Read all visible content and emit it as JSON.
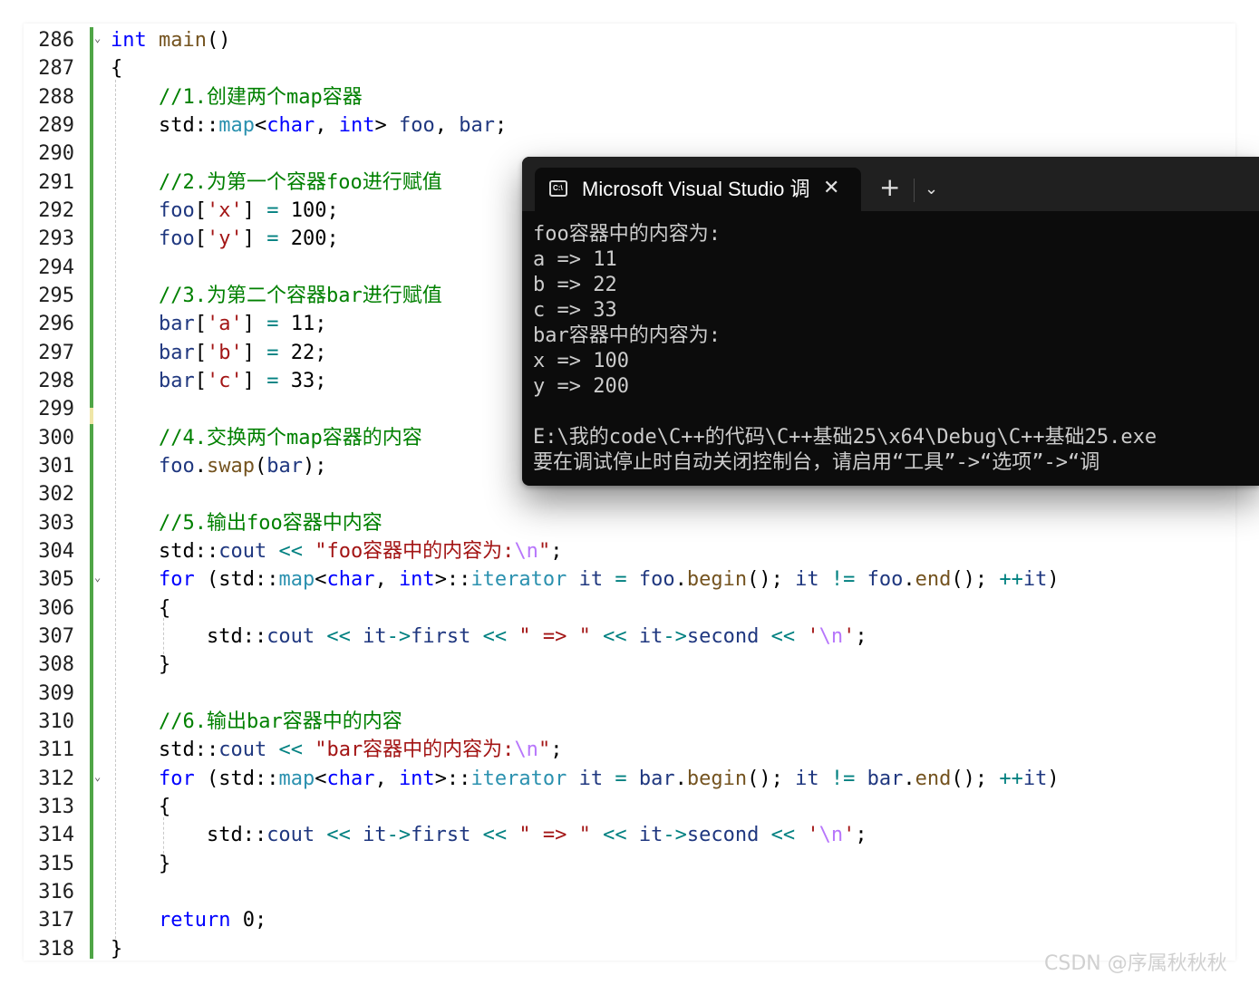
{
  "editor": {
    "lines": [
      {
        "n": "286",
        "fold": "⌄",
        "tokens": [
          [
            "kw",
            "int"
          ],
          [
            "p",
            " "
          ],
          [
            "fn",
            "main"
          ],
          [
            "p",
            "()"
          ]
        ]
      },
      {
        "n": "287",
        "tokens": [
          [
            "p",
            "{"
          ]
        ]
      },
      {
        "n": "288",
        "tokens": [
          [
            "p",
            "    "
          ],
          [
            "cm",
            "//1.创建两个map容器"
          ]
        ]
      },
      {
        "n": "289",
        "tokens": [
          [
            "p",
            "    std::"
          ],
          [
            "ty",
            "map"
          ],
          [
            "p",
            "<"
          ],
          [
            "kw",
            "char"
          ],
          [
            "p",
            ", "
          ],
          [
            "kw",
            "int"
          ],
          [
            "p",
            "> "
          ],
          [
            "var",
            "foo"
          ],
          [
            "p",
            ", "
          ],
          [
            "var",
            "bar"
          ],
          [
            "p",
            ";"
          ]
        ]
      },
      {
        "n": "290",
        "tokens": []
      },
      {
        "n": "291",
        "tokens": [
          [
            "p",
            "    "
          ],
          [
            "cm",
            "//2.为第一个容器foo进行赋值"
          ]
        ]
      },
      {
        "n": "292",
        "tokens": [
          [
            "p",
            "    "
          ],
          [
            "var",
            "foo"
          ],
          [
            "p",
            "["
          ],
          [
            "str",
            "'x'"
          ],
          [
            "p",
            "] "
          ],
          [
            "op",
            "="
          ],
          [
            "p",
            " 100;"
          ]
        ]
      },
      {
        "n": "293",
        "tokens": [
          [
            "p",
            "    "
          ],
          [
            "var",
            "foo"
          ],
          [
            "p",
            "["
          ],
          [
            "str",
            "'y'"
          ],
          [
            "p",
            "] "
          ],
          [
            "op",
            "="
          ],
          [
            "p",
            " 200;"
          ]
        ]
      },
      {
        "n": "294",
        "tokens": []
      },
      {
        "n": "295",
        "tokens": [
          [
            "p",
            "    "
          ],
          [
            "cm",
            "//3.为第二个容器bar进行赋值"
          ]
        ]
      },
      {
        "n": "296",
        "tokens": [
          [
            "p",
            "    "
          ],
          [
            "var",
            "bar"
          ],
          [
            "p",
            "["
          ],
          [
            "str",
            "'a'"
          ],
          [
            "p",
            "] "
          ],
          [
            "op",
            "="
          ],
          [
            "p",
            " 11;"
          ]
        ]
      },
      {
        "n": "297",
        "tokens": [
          [
            "p",
            "    "
          ],
          [
            "var",
            "bar"
          ],
          [
            "p",
            "["
          ],
          [
            "str",
            "'b'"
          ],
          [
            "p",
            "] "
          ],
          [
            "op",
            "="
          ],
          [
            "p",
            " 22;"
          ]
        ]
      },
      {
        "n": "298",
        "tokens": [
          [
            "p",
            "    "
          ],
          [
            "var",
            "bar"
          ],
          [
            "p",
            "["
          ],
          [
            "str",
            "'c'"
          ],
          [
            "p",
            "] "
          ],
          [
            "op",
            "="
          ],
          [
            "p",
            " 33;"
          ]
        ]
      },
      {
        "n": "299",
        "tokens": []
      },
      {
        "n": "300",
        "tokens": [
          [
            "p",
            "    "
          ],
          [
            "cm",
            "//4.交换两个map容器的内容"
          ]
        ]
      },
      {
        "n": "301",
        "tokens": [
          [
            "p",
            "    "
          ],
          [
            "var",
            "foo"
          ],
          [
            "p",
            "."
          ],
          [
            "fn",
            "swap"
          ],
          [
            "p",
            "("
          ],
          [
            "var",
            "bar"
          ],
          [
            "p",
            ");"
          ]
        ]
      },
      {
        "n": "302",
        "tokens": []
      },
      {
        "n": "303",
        "tokens": [
          [
            "p",
            "    "
          ],
          [
            "cm",
            "//5.输出foo容器中内容"
          ]
        ]
      },
      {
        "n": "304",
        "tokens": [
          [
            "p",
            "    std::"
          ],
          [
            "var",
            "cout"
          ],
          [
            "p",
            " "
          ],
          [
            "op",
            "<<"
          ],
          [
            "p",
            " "
          ],
          [
            "str",
            "\"foo容器中的内容为:"
          ],
          [
            "esc",
            "\\n"
          ],
          [
            "str",
            "\""
          ],
          [
            "p",
            ";"
          ]
        ]
      },
      {
        "n": "305",
        "fold": "⌄",
        "tokens": [
          [
            "p",
            "    "
          ],
          [
            "kw",
            "for"
          ],
          [
            "p",
            " (std::"
          ],
          [
            "ty",
            "map"
          ],
          [
            "p",
            "<"
          ],
          [
            "kw",
            "char"
          ],
          [
            "p",
            ", "
          ],
          [
            "kw",
            "int"
          ],
          [
            "p",
            ">::"
          ],
          [
            "ty",
            "iterator"
          ],
          [
            "p",
            " "
          ],
          [
            "var",
            "it"
          ],
          [
            "p",
            " "
          ],
          [
            "op",
            "="
          ],
          [
            "p",
            " "
          ],
          [
            "var",
            "foo"
          ],
          [
            "p",
            "."
          ],
          [
            "fn",
            "begin"
          ],
          [
            "p",
            "(); "
          ],
          [
            "var",
            "it"
          ],
          [
            "p",
            " "
          ],
          [
            "op",
            "!="
          ],
          [
            "p",
            " "
          ],
          [
            "var",
            "foo"
          ],
          [
            "p",
            "."
          ],
          [
            "fn",
            "end"
          ],
          [
            "p",
            "(); "
          ],
          [
            "op",
            "++"
          ],
          [
            "var",
            "it"
          ],
          [
            "p",
            ")"
          ]
        ]
      },
      {
        "n": "306",
        "tokens": [
          [
            "p",
            "    {"
          ]
        ]
      },
      {
        "n": "307",
        "tokens": [
          [
            "p",
            "        std::"
          ],
          [
            "var",
            "cout"
          ],
          [
            "p",
            " "
          ],
          [
            "op",
            "<<"
          ],
          [
            "p",
            " "
          ],
          [
            "var",
            "it"
          ],
          [
            "op",
            "->"
          ],
          [
            "var",
            "first"
          ],
          [
            "p",
            " "
          ],
          [
            "op",
            "<<"
          ],
          [
            "p",
            " "
          ],
          [
            "str",
            "\" => \""
          ],
          [
            "p",
            " "
          ],
          [
            "op",
            "<<"
          ],
          [
            "p",
            " "
          ],
          [
            "var",
            "it"
          ],
          [
            "op",
            "->"
          ],
          [
            "var",
            "second"
          ],
          [
            "p",
            " "
          ],
          [
            "op",
            "<<"
          ],
          [
            "p",
            " "
          ],
          [
            "str",
            "'"
          ],
          [
            "esc",
            "\\n"
          ],
          [
            "str",
            "'"
          ],
          [
            "p",
            ";"
          ]
        ]
      },
      {
        "n": "308",
        "tokens": [
          [
            "p",
            "    }"
          ]
        ]
      },
      {
        "n": "309",
        "tokens": []
      },
      {
        "n": "310",
        "tokens": [
          [
            "p",
            "    "
          ],
          [
            "cm",
            "//6.输出bar容器中的内容"
          ]
        ]
      },
      {
        "n": "311",
        "tokens": [
          [
            "p",
            "    std::"
          ],
          [
            "var",
            "cout"
          ],
          [
            "p",
            " "
          ],
          [
            "op",
            "<<"
          ],
          [
            "p",
            " "
          ],
          [
            "str",
            "\"bar容器中的内容为:"
          ],
          [
            "esc",
            "\\n"
          ],
          [
            "str",
            "\""
          ],
          [
            "p",
            ";"
          ]
        ]
      },
      {
        "n": "312",
        "fold": "⌄",
        "tokens": [
          [
            "p",
            "    "
          ],
          [
            "kw",
            "for"
          ],
          [
            "p",
            " (std::"
          ],
          [
            "ty",
            "map"
          ],
          [
            "p",
            "<"
          ],
          [
            "kw",
            "char"
          ],
          [
            "p",
            ", "
          ],
          [
            "kw",
            "int"
          ],
          [
            "p",
            ">::"
          ],
          [
            "ty",
            "iterator"
          ],
          [
            "p",
            " "
          ],
          [
            "var",
            "it"
          ],
          [
            "p",
            " "
          ],
          [
            "op",
            "="
          ],
          [
            "p",
            " "
          ],
          [
            "var",
            "bar"
          ],
          [
            "p",
            "."
          ],
          [
            "fn",
            "begin"
          ],
          [
            "p",
            "(); "
          ],
          [
            "var",
            "it"
          ],
          [
            "p",
            " "
          ],
          [
            "op",
            "!="
          ],
          [
            "p",
            " "
          ],
          [
            "var",
            "bar"
          ],
          [
            "p",
            "."
          ],
          [
            "fn",
            "end"
          ],
          [
            "p",
            "(); "
          ],
          [
            "op",
            "++"
          ],
          [
            "var",
            "it"
          ],
          [
            "p",
            ")"
          ]
        ]
      },
      {
        "n": "313",
        "tokens": [
          [
            "p",
            "    {"
          ]
        ]
      },
      {
        "n": "314",
        "tokens": [
          [
            "p",
            "        std::"
          ],
          [
            "var",
            "cout"
          ],
          [
            "p",
            " "
          ],
          [
            "op",
            "<<"
          ],
          [
            "p",
            " "
          ],
          [
            "var",
            "it"
          ],
          [
            "op",
            "->"
          ],
          [
            "var",
            "first"
          ],
          [
            "p",
            " "
          ],
          [
            "op",
            "<<"
          ],
          [
            "p",
            " "
          ],
          [
            "str",
            "\" => \""
          ],
          [
            "p",
            " "
          ],
          [
            "op",
            "<<"
          ],
          [
            "p",
            " "
          ],
          [
            "var",
            "it"
          ],
          [
            "op",
            "->"
          ],
          [
            "var",
            "second"
          ],
          [
            "p",
            " "
          ],
          [
            "op",
            "<<"
          ],
          [
            "p",
            " "
          ],
          [
            "str",
            "'"
          ],
          [
            "esc",
            "\\n"
          ],
          [
            "str",
            "'"
          ],
          [
            "p",
            ";"
          ]
        ]
      },
      {
        "n": "315",
        "tokens": [
          [
            "p",
            "    }"
          ]
        ]
      },
      {
        "n": "316",
        "tokens": []
      },
      {
        "n": "317",
        "tokens": [
          [
            "p",
            "    "
          ],
          [
            "kw",
            "return"
          ],
          [
            "p",
            " 0;"
          ]
        ]
      },
      {
        "n": "318",
        "tokens": [
          [
            "p",
            "}"
          ]
        ]
      }
    ]
  },
  "console": {
    "tab_title": "Microsoft Visual Studio 调试控制台",
    "tab_icon_text": "C:\\",
    "close_glyph": "✕",
    "new_tab_glyph": "+",
    "menu_glyph": "⌄",
    "output": [
      "foo容器中的内容为:",
      "a => 11",
      "b => 22",
      "c => 33",
      "bar容器中的内容为:",
      "x => 100",
      "y => 200",
      "",
      "E:\\我的code\\C++的代码\\C++基础25\\x64\\Debug\\C++基础25.exe",
      "要在调试停止时自动关闭控制台，请启用“工具”->“选项”->“调"
    ]
  },
  "watermark": "CSDN @序属秋秋秋",
  "colors": {
    "keyword": "#0000ff",
    "function": "#74531f",
    "variable": "#1f377f",
    "comment": "#008000",
    "string": "#a31515",
    "escape": "#b776fb",
    "type": "#2b91af",
    "operator": "#008080",
    "change_bar": "#4fa546",
    "console_bg": "#0c0c0c"
  }
}
